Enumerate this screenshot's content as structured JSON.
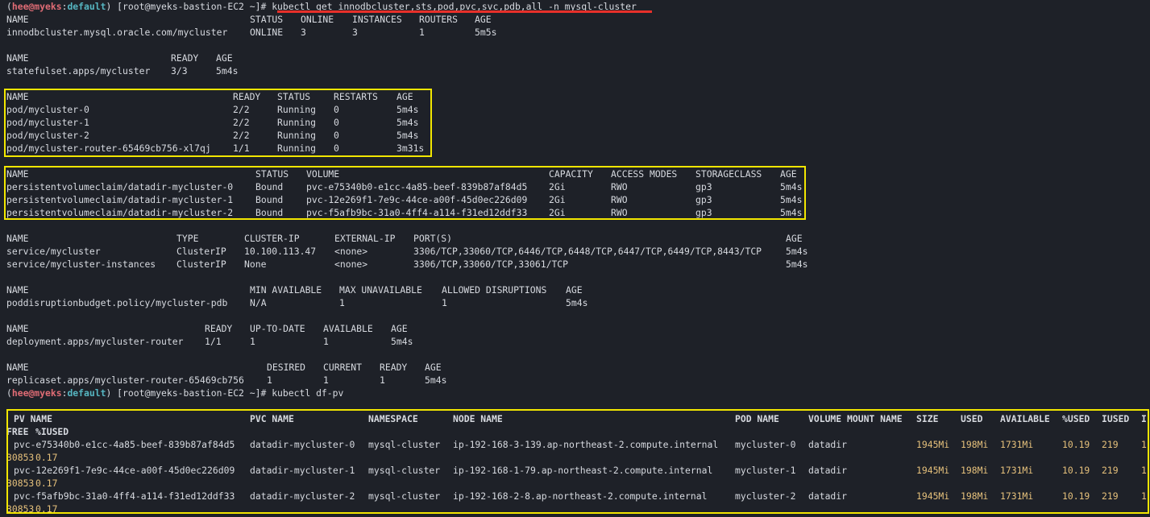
{
  "prompts": [
    {
      "user": "hee@myeks",
      "env": "default",
      "host": " [root@myeks-bastion-EC2 ~]# ",
      "cmd": "kubectl get innodbcluster,sts,pod,pvc,svc,pdb,all -n mysql-cluster"
    },
    {
      "user": "hee@myeks",
      "env": "default",
      "host": " [root@myeks-bastion-EC2 ~]# ",
      "cmd": "kubectl df-pv"
    }
  ],
  "innodb": {
    "header": [
      "NAME",
      "STATUS",
      "ONLINE",
      "INSTANCES",
      "ROUTERS",
      "AGE"
    ],
    "rows": [
      [
        "innodbcluster.mysql.oracle.com/mycluster",
        "ONLINE",
        "3",
        "3",
        "1",
        "5m5s"
      ]
    ]
  },
  "sts": {
    "header": [
      "NAME",
      "READY",
      "AGE"
    ],
    "rows": [
      [
        "statefulset.apps/mycluster",
        "3/3",
        "5m4s"
      ]
    ]
  },
  "pods": {
    "header": [
      "NAME",
      "READY",
      "STATUS",
      "RESTARTS",
      "AGE"
    ],
    "rows": [
      [
        "pod/mycluster-0",
        "2/2",
        "Running",
        "0",
        "5m4s"
      ],
      [
        "pod/mycluster-1",
        "2/2",
        "Running",
        "0",
        "5m4s"
      ],
      [
        "pod/mycluster-2",
        "2/2",
        "Running",
        "0",
        "5m4s"
      ],
      [
        "pod/mycluster-router-65469cb756-xl7qj",
        "1/1",
        "Running",
        "0",
        "3m31s"
      ]
    ]
  },
  "pvc": {
    "header": [
      "NAME",
      "STATUS",
      "VOLUME",
      "CAPACITY",
      "ACCESS MODES",
      "STORAGECLASS",
      "AGE"
    ],
    "rows": [
      [
        "persistentvolumeclaim/datadir-mycluster-0",
        "Bound",
        "pvc-e75340b0-e1cc-4a85-beef-839b87af84d5",
        "2Gi",
        "RWO",
        "gp3",
        "5m4s"
      ],
      [
        "persistentvolumeclaim/datadir-mycluster-1",
        "Bound",
        "pvc-12e269f1-7e9c-44ce-a00f-45d0ec226d09",
        "2Gi",
        "RWO",
        "gp3",
        "5m4s"
      ],
      [
        "persistentvolumeclaim/datadir-mycluster-2",
        "Bound",
        "pvc-f5afb9bc-31a0-4ff4-a114-f31ed12ddf33",
        "2Gi",
        "RWO",
        "gp3",
        "5m4s"
      ]
    ]
  },
  "svc": {
    "header": [
      "NAME",
      "TYPE",
      "CLUSTER-IP",
      "EXTERNAL-IP",
      "PORT(S)",
      "AGE"
    ],
    "rows": [
      [
        "service/mycluster",
        "ClusterIP",
        "10.100.113.47",
        "<none>",
        "3306/TCP,33060/TCP,6446/TCP,6448/TCP,6447/TCP,6449/TCP,8443/TCP",
        "5m4s"
      ],
      [
        "service/mycluster-instances",
        "ClusterIP",
        "None",
        "<none>",
        "3306/TCP,33060/TCP,33061/TCP",
        "5m4s"
      ]
    ]
  },
  "pdb": {
    "header": [
      "NAME",
      "MIN AVAILABLE",
      "MAX UNAVAILABLE",
      "ALLOWED DISRUPTIONS",
      "AGE"
    ],
    "rows": [
      [
        "poddisruptionbudget.policy/mycluster-pdb",
        "N/A",
        "1",
        "1",
        "5m4s"
      ]
    ]
  },
  "deploy": {
    "header": [
      "NAME",
      "READY",
      "UP-TO-DATE",
      "AVAILABLE",
      "AGE"
    ],
    "rows": [
      [
        "deployment.apps/mycluster-router",
        "1/1",
        "1",
        "1",
        "5m4s"
      ]
    ]
  },
  "rs": {
    "header": [
      "NAME",
      "DESIRED",
      "CURRENT",
      "READY",
      "AGE"
    ],
    "rows": [
      [
        "replicaset.apps/mycluster-router-65469cb756",
        "1",
        "1",
        "1",
        "5m4s"
      ]
    ]
  },
  "dfpv": {
    "header": [
      "PV NAME",
      "PVC NAME",
      "NAMESPACE",
      "NODE NAME",
      "POD NAME",
      "VOLUME MOUNT NAME",
      "SIZE",
      "USED",
      "AVAILABLE",
      "%USED",
      "IUSED",
      "I"
    ],
    "header2": [
      "FREE",
      "%IUSED"
    ],
    "rows": [
      {
        "cells": [
          "pvc-e75340b0-e1cc-4a85-beef-839b87af84d5",
          "datadir-mycluster-0",
          "mysql-cluster",
          "ip-192-168-3-139.ap-northeast-2.compute.internal",
          "mycluster-0",
          "datadir",
          "1945Mi",
          "198Mi",
          "1731Mi",
          "10.19",
          "219",
          "1"
        ],
        "wrap": [
          "30853",
          "0.17"
        ]
      },
      {
        "cells": [
          "pvc-12e269f1-7e9c-44ce-a00f-45d0ec226d09",
          "datadir-mycluster-1",
          "mysql-cluster",
          "ip-192-168-1-79.ap-northeast-2.compute.internal",
          "mycluster-1",
          "datadir",
          "1945Mi",
          "198Mi",
          "1731Mi",
          "10.19",
          "219",
          "1"
        ],
        "wrap": [
          "30853",
          "0.17"
        ]
      },
      {
        "cells": [
          "pvc-f5afb9bc-31a0-4ff4-a114-f31ed12ddf33",
          "datadir-mycluster-2",
          "mysql-cluster",
          "ip-192-168-2-8.ap-northeast-2.compute.internal",
          "mycluster-2",
          "datadir",
          "1945Mi",
          "198Mi",
          "1731Mi",
          "10.19",
          "219",
          "1"
        ],
        "wrap": [
          "30853",
          "0.17"
        ]
      }
    ]
  },
  "colors": {
    "background": "#1e2128",
    "text": "#d7dae0",
    "user": "#e06c75",
    "env": "#56b6c2",
    "numbers": "#e5c07b",
    "highlight": "#f2e600",
    "underline": "#e8302a"
  }
}
